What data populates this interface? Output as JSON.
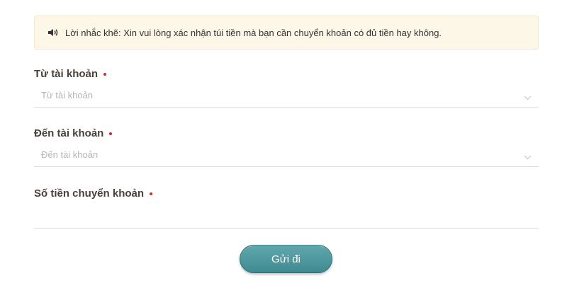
{
  "notice": {
    "icon": "speaker-icon",
    "text": "Lời nhắc khẽ: Xin vui lòng xác nhận túi tiền mà bạn cần chuyển khoản có đủ tiền hay không."
  },
  "form": {
    "from_account": {
      "label": "Từ tài khoản",
      "placeholder": "Từ tài khoản",
      "required_color": "#c0322b"
    },
    "to_account": {
      "label": "Đến tài khoản",
      "placeholder": "Đến tài khoản",
      "required_color": "#c0322b"
    },
    "amount": {
      "label": "Số tiền chuyển khoản",
      "value": "",
      "required_color": "#c0322b"
    },
    "submit_label": "Gửi đi",
    "submit_color": "#4f989e"
  }
}
